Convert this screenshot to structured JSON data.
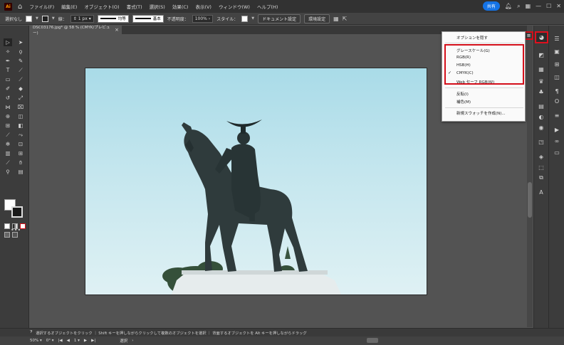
{
  "app": {
    "logo": "Ai"
  },
  "menubar": {
    "items": [
      "ファイル(F)",
      "編集(E)",
      "オブジェクト(O)",
      "書式(T)",
      "選択(S)",
      "効果(C)",
      "表示(V)",
      "ウィンドウ(W)",
      "ヘルプ(H)"
    ],
    "share_label": "共有"
  },
  "control_bar": {
    "selection_label": "選択なし",
    "stroke_label": "線：",
    "stroke_weight": "1 px",
    "profile_label": "均等",
    "brush_label": "基本",
    "opacity_label": "不透明度：",
    "opacity_value": "100%",
    "style_label": "スタイル：",
    "doc_settings_label": "ドキュメント設定",
    "prefs_label": "環境設定"
  },
  "document": {
    "tab_title": "DSC03176.jpg* @ 58 % (CMYK/プレビュー)"
  },
  "swatch_menu": {
    "hide_options": "オプションを隠す",
    "items": [
      "グレースケール(G)",
      "RGB(R)",
      "HSB(H)",
      "CMYK(C)",
      "Web セーフ RGB(W)"
    ],
    "checked": "CMYK(C)",
    "invert": "反転(I)",
    "complement": "補色(M)",
    "new_swatch": "新規スウォッチを作成(N)..."
  },
  "status_bar": {
    "hint": "選択するオブジェクトをクリック ｜ Shift キーを押しながらクリックして複数のオブジェクトを選択 ｜ 背面するオブジェクトを Alt キーを押しながらドラッグ"
  },
  "bottom_bar": {
    "zoom": "50%",
    "rotation": "0°",
    "artboard": "1",
    "mode": "選択"
  },
  "colors": {
    "accent": "#1473e6",
    "highlight": "#d40f1a",
    "sky": "#a9dbe8"
  }
}
